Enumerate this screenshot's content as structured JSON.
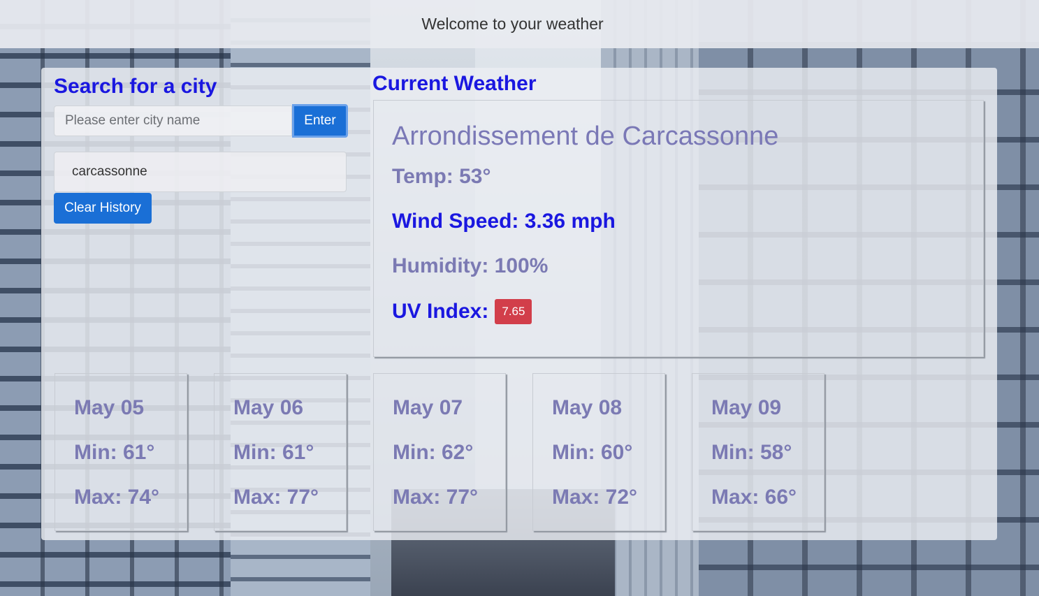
{
  "header": {
    "title": "Welcome to your weather"
  },
  "search": {
    "heading": "Search for a city",
    "placeholder": "Please enter city name",
    "value": "",
    "enter_label": "Enter",
    "history": [
      "carcassonne"
    ],
    "clear_label": "Clear History"
  },
  "current": {
    "heading": "Current Weather",
    "city": "Arrondissement de Carcassonne",
    "temp": "Temp: 53°",
    "wind": "Wind Speed: 3.36 mph",
    "humidity": "Humidity: 100%",
    "uv_label": "UV Index:",
    "uv_value": "7.65"
  },
  "forecast": [
    {
      "date": "May 05",
      "min": "Min: 61°",
      "max": "Max: 74°"
    },
    {
      "date": "May 06",
      "min": "Min: 61°",
      "max": "Max: 77°"
    },
    {
      "date": "May 07",
      "min": "Min: 62°",
      "max": "Max: 77°"
    },
    {
      "date": "May 08",
      "min": "Min: 60°",
      "max": "Max: 72°"
    },
    {
      "date": "May 09",
      "min": "Min: 58°",
      "max": "Max: 66°"
    }
  ],
  "colors": {
    "heading": "#1a17e0",
    "muted_text": "#7b7ab3",
    "primary_button": "#1a6fd6",
    "uv_badge": "#d23e4a"
  }
}
